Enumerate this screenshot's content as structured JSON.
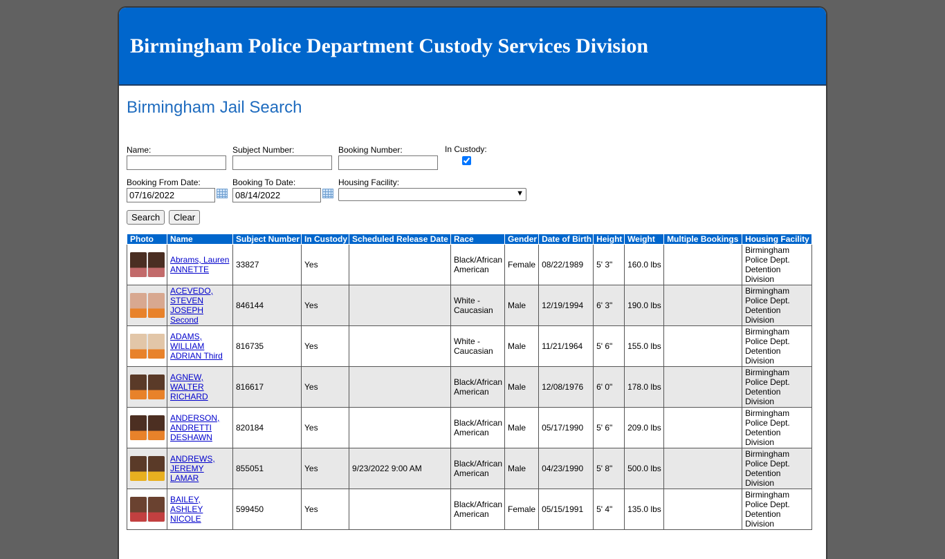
{
  "header": {
    "title": "Birmingham Police Department Custody Services Division"
  },
  "page_title": "Birmingham Jail Search",
  "form": {
    "name_label": "Name:",
    "name_value": "",
    "subject_label": "Subject Number:",
    "subject_value": "",
    "booking_label": "Booking Number:",
    "booking_value": "",
    "custody_label": "In Custody:",
    "from_label": "Booking From Date:",
    "from_value": "07/16/2022",
    "to_label": "Booking To Date:",
    "to_value": "08/14/2022",
    "facility_label": "Housing Facility:",
    "facility_value": "",
    "search_label": "Search",
    "clear_label": "Clear"
  },
  "table": {
    "headers": [
      "Photo",
      "Name",
      "Subject Number",
      "In Custody",
      "Scheduled Release Date",
      "Race",
      "Gender",
      "Date of Birth",
      "Height",
      "Weight",
      "Multiple Bookings",
      "Housing Facility"
    ],
    "rows": [
      {
        "name": "Abrams, Lauren ANNETTE",
        "subject": "33827",
        "custody": "Yes",
        "release": "",
        "race": "Black/African American",
        "gender": "Female",
        "dob": "08/22/1989",
        "height": "5' 3\"",
        "weight": "160.0 lbs",
        "multi": "",
        "facility": "Birmingham Police Dept. Detention Division",
        "shirt": "#c26a6a",
        "skin": "#4a2e22"
      },
      {
        "name": "ACEVEDO, STEVEN JOSEPH Second",
        "subject": "846144",
        "custody": "Yes",
        "release": "",
        "race": "White - Caucasian",
        "gender": "Male",
        "dob": "12/19/1994",
        "height": "6' 3\"",
        "weight": "190.0 lbs",
        "multi": "",
        "facility": "Birmingham Police Dept. Detention Division",
        "shirt": "#e8822a",
        "skin": "#d8a890"
      },
      {
        "name": "ADAMS, WILLIAM ADRIAN Third",
        "subject": "816735",
        "custody": "Yes",
        "release": "",
        "race": "White - Caucasian",
        "gender": "Male",
        "dob": "11/21/1964",
        "height": "5' 6\"",
        "weight": "155.0 lbs",
        "multi": "",
        "facility": "Birmingham Police Dept. Detention Division",
        "shirt": "#e8822a",
        "skin": "#e2c6a8"
      },
      {
        "name": "AGNEW, WALTER RICHARD",
        "subject": "816617",
        "custody": "Yes",
        "release": "",
        "race": "Black/African American",
        "gender": "Male",
        "dob": "12/08/1976",
        "height": "6' 0\"",
        "weight": "178.0 lbs",
        "multi": "",
        "facility": "Birmingham Police Dept. Detention Division",
        "shirt": "#e8822a",
        "skin": "#5a3a28"
      },
      {
        "name": "ANDERSON, ANDRETTI DESHAWN",
        "subject": "820184",
        "custody": "Yes",
        "release": "",
        "race": "Black/African American",
        "gender": "Male",
        "dob": "05/17/1990",
        "height": "5' 6\"",
        "weight": "209.0 lbs",
        "multi": "",
        "facility": "Birmingham Police Dept. Detention Division",
        "shirt": "#e8822a",
        "skin": "#4c2f22"
      },
      {
        "name": "ANDREWS, JEREMY LAMAR",
        "subject": "855051",
        "custody": "Yes",
        "release": "9/23/2022 9:00 AM",
        "race": "Black/African American",
        "gender": "Male",
        "dob": "04/23/1990",
        "height": "5' 8\"",
        "weight": "500.0 lbs",
        "multi": "",
        "facility": "Birmingham Police Dept. Detention Division",
        "shirt": "#e8b020",
        "skin": "#5a3a28"
      },
      {
        "name": "BAILEY, ASHLEY NICOLE",
        "subject": "599450",
        "custody": "Yes",
        "release": "",
        "race": "Black/African American",
        "gender": "Female",
        "dob": "05/15/1991",
        "height": "5' 4\"",
        "weight": "135.0 lbs",
        "multi": "",
        "facility": "Birmingham Police Dept. Detention Division",
        "shirt": "#c24040",
        "skin": "#6a4230"
      }
    ]
  },
  "colors": {
    "banner": "#0066cc",
    "title": "#1f6cbf",
    "link": "#0000cc"
  }
}
